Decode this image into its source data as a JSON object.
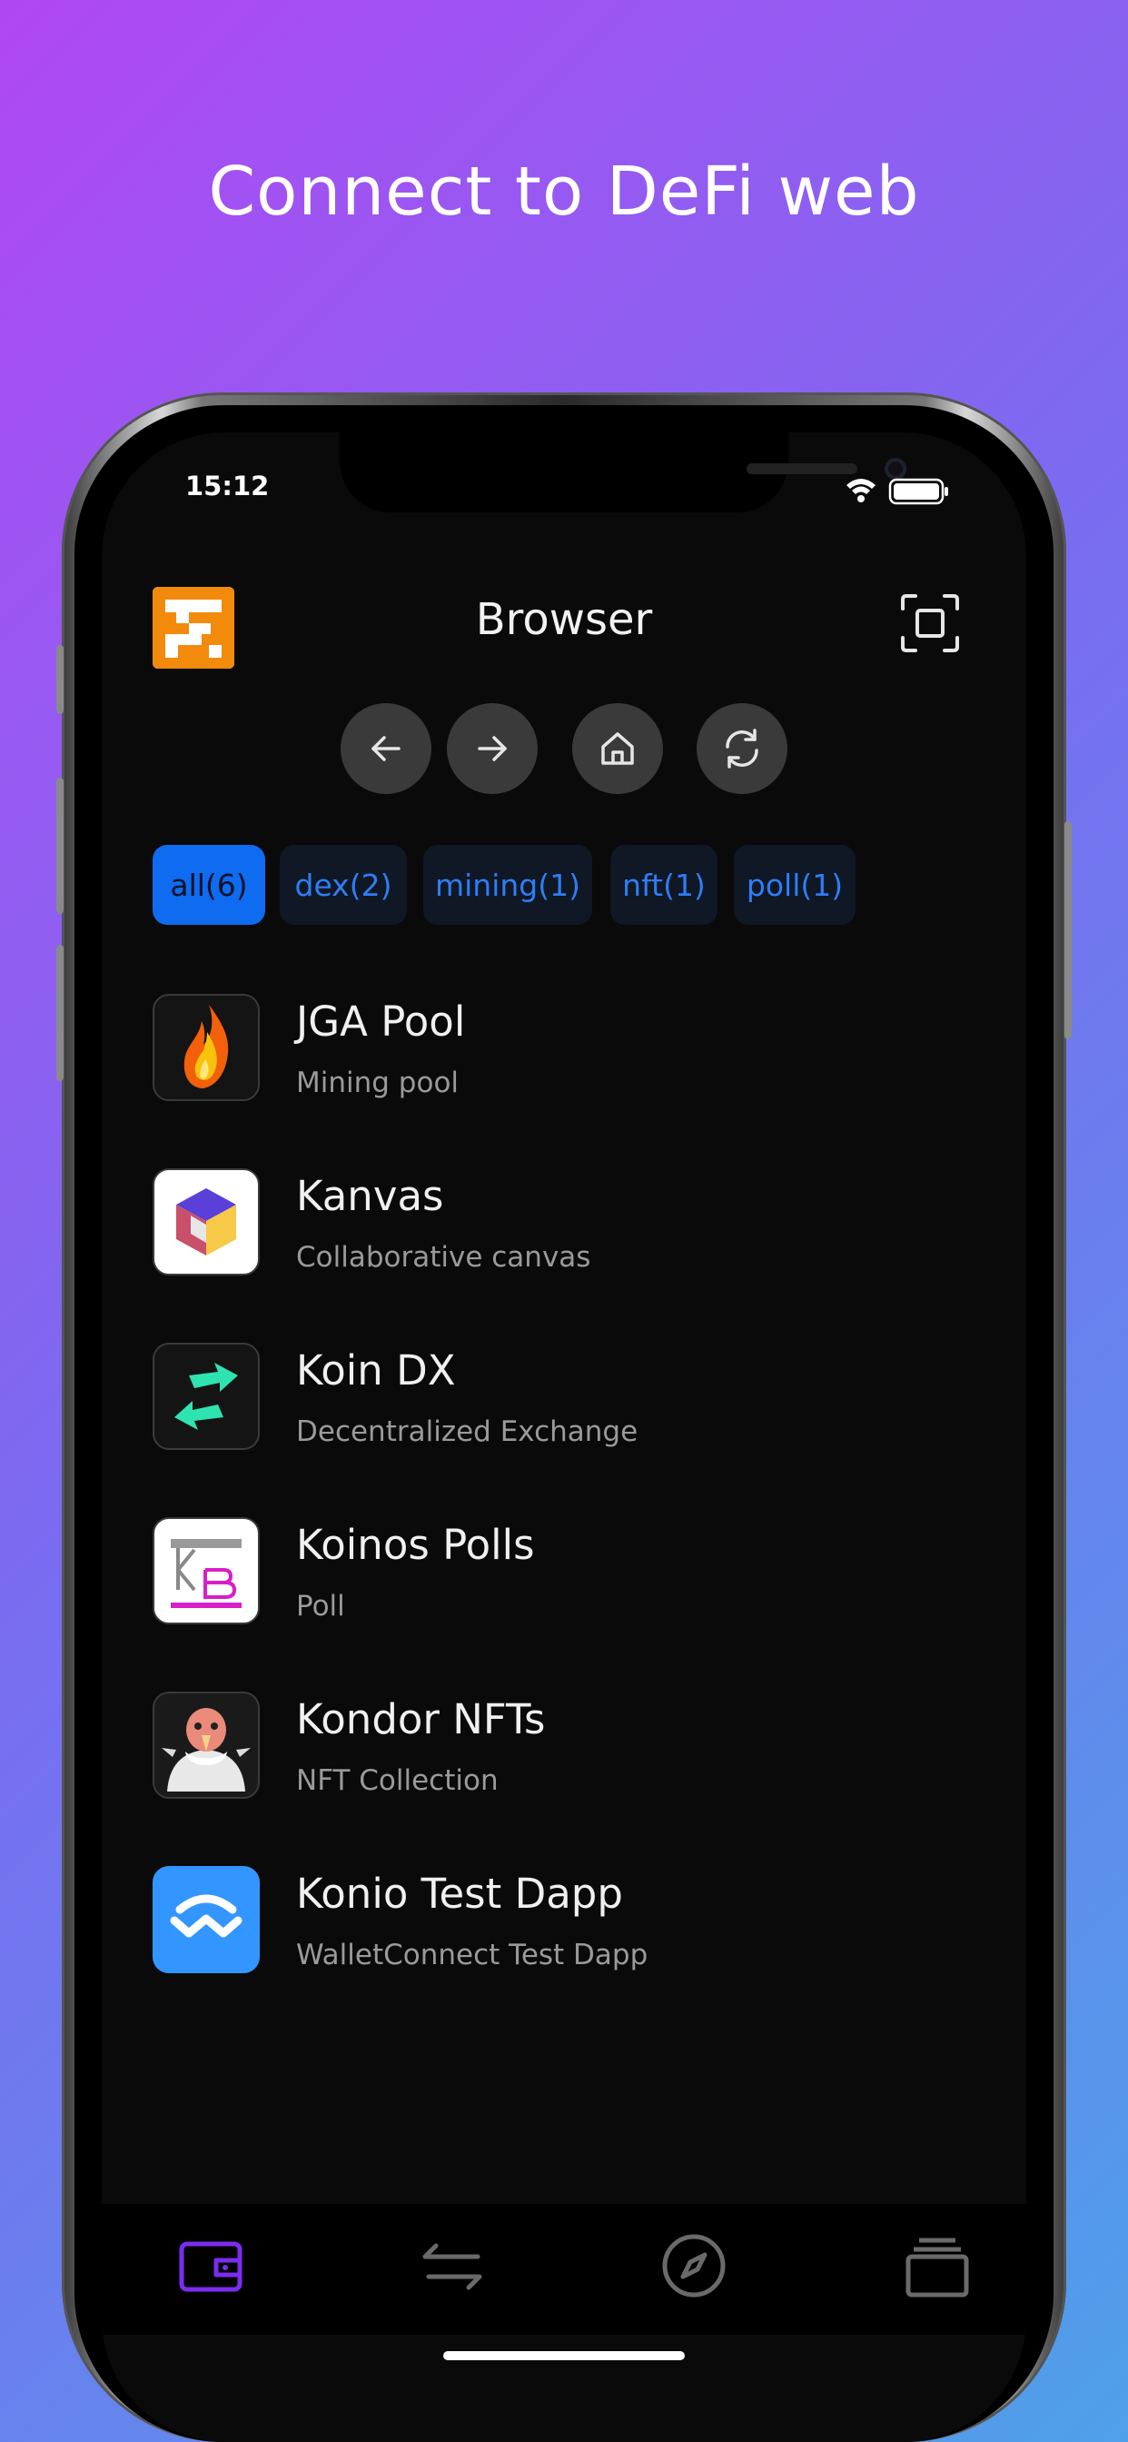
{
  "headline": "Connect to DeFi web",
  "status_bar": {
    "time": "15:12",
    "icons": [
      "wifi-icon",
      "battery-icon"
    ]
  },
  "header": {
    "title": "Browser",
    "logo": "app-logo",
    "scan_icon": "scan-icon"
  },
  "navigation": [
    "arrow-left-icon",
    "arrow-right-icon",
    "home-icon",
    "refresh-icon"
  ],
  "filters": [
    {
      "label": "all(6)",
      "active": true
    },
    {
      "label": "dex(2)",
      "active": false
    },
    {
      "label": "mining(1)",
      "active": false
    },
    {
      "label": "nft(1)",
      "active": false
    },
    {
      "label": "poll(1)",
      "active": false
    }
  ],
  "dapps": [
    {
      "name": "JGA Pool",
      "description": "Mining pool",
      "icon": "flame-icon"
    },
    {
      "name": "Kanvas",
      "description": "Collaborative canvas",
      "icon": "cube-icon"
    },
    {
      "name": "Koin DX",
      "description": "Decentralized Exchange",
      "icon": "exchange-arrows-icon"
    },
    {
      "name": "Koinos Polls",
      "description": "Poll",
      "icon": "kb-logo-icon"
    },
    {
      "name": "Kondor NFTs",
      "description": "NFT Collection",
      "icon": "condor-icon"
    },
    {
      "name": "Konio Test Dapp",
      "description": "WalletConnect Test Dapp",
      "icon": "walletconnect-icon"
    }
  ],
  "tabbar": [
    "wallet-icon",
    "transfer-icon",
    "compass-icon",
    "stack-icon"
  ],
  "colors": {
    "accent": "#0f6bf0",
    "chip_text": "#2f7df7",
    "wallet_tab": "#7a2cf0",
    "background": "#0a0a0a"
  }
}
